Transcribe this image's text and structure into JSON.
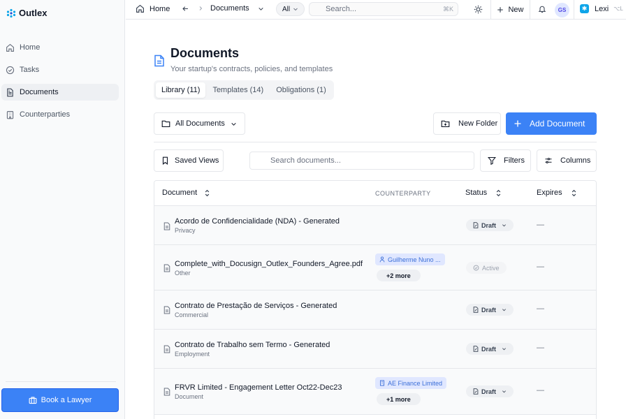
{
  "app": {
    "name": "Outlex",
    "brand_color": "#3b82f6"
  },
  "sidebar": {
    "items": [
      {
        "label": "Home",
        "icon": "home-icon",
        "active": false
      },
      {
        "label": "Tasks",
        "icon": "check-circle-icon",
        "active": false
      },
      {
        "label": "Documents",
        "icon": "document-icon",
        "active": true
      },
      {
        "label": "Counterparties",
        "icon": "building-icon",
        "active": false
      }
    ],
    "book_lawyer": "Book a Lawyer"
  },
  "topbar": {
    "home": "Home",
    "breadcrumb_current": "Documents",
    "scope": "All",
    "search_placeholder": "Search...",
    "search_shortcut": "⌘K",
    "new_label": "New",
    "avatar_initials": "GS",
    "assistant": "Lexi",
    "assistant_shortcut": "⌥L"
  },
  "page": {
    "title": "Documents",
    "subtitle": "Your startup's contracts, policies, and templates",
    "tabs": [
      {
        "label": "Library (11)",
        "active": true
      },
      {
        "label": "Templates (14)",
        "active": false
      },
      {
        "label": "Obligations (1)",
        "active": false
      }
    ]
  },
  "toolbar": {
    "all_documents": "All Documents",
    "new_folder": "New Folder",
    "add_document": "Add Document",
    "saved_views": "Saved Views",
    "search_placeholder": "Search documents...",
    "filters": "Filters",
    "columns": "Columns"
  },
  "table": {
    "headers": {
      "document": "Document",
      "counterparty": "COUNTERPARTY",
      "status": "Status",
      "expires": "Expires"
    },
    "rows": [
      {
        "name": "Acordo de Confidencialidade (NDA) - Generated",
        "category": "Privacy",
        "counterparty": "",
        "more": "",
        "status": "Draft",
        "expires": "—"
      },
      {
        "name": "Complete_with_Docusign_Outlex_Founders_Agree.pdf",
        "category": "Other",
        "counterparty": "Guilherme Nuno ...",
        "more": "+2 more",
        "status": "Active",
        "expires": "—"
      },
      {
        "name": "Contrato de Prestação de Serviços - Generated",
        "category": "Commercial",
        "counterparty": "",
        "more": "",
        "status": "Draft",
        "expires": "—"
      },
      {
        "name": "Contrato de Trabalho sem Termo - Generated",
        "category": "Employment",
        "counterparty": "",
        "more": "",
        "status": "Draft",
        "expires": "—"
      },
      {
        "name": "FRVR Limited - Engagement Letter Oct22-Dec23",
        "category": "Document",
        "counterparty": "AE Finance Limited",
        "more": "+1 more",
        "status": "Draft",
        "expires": "—"
      }
    ]
  }
}
